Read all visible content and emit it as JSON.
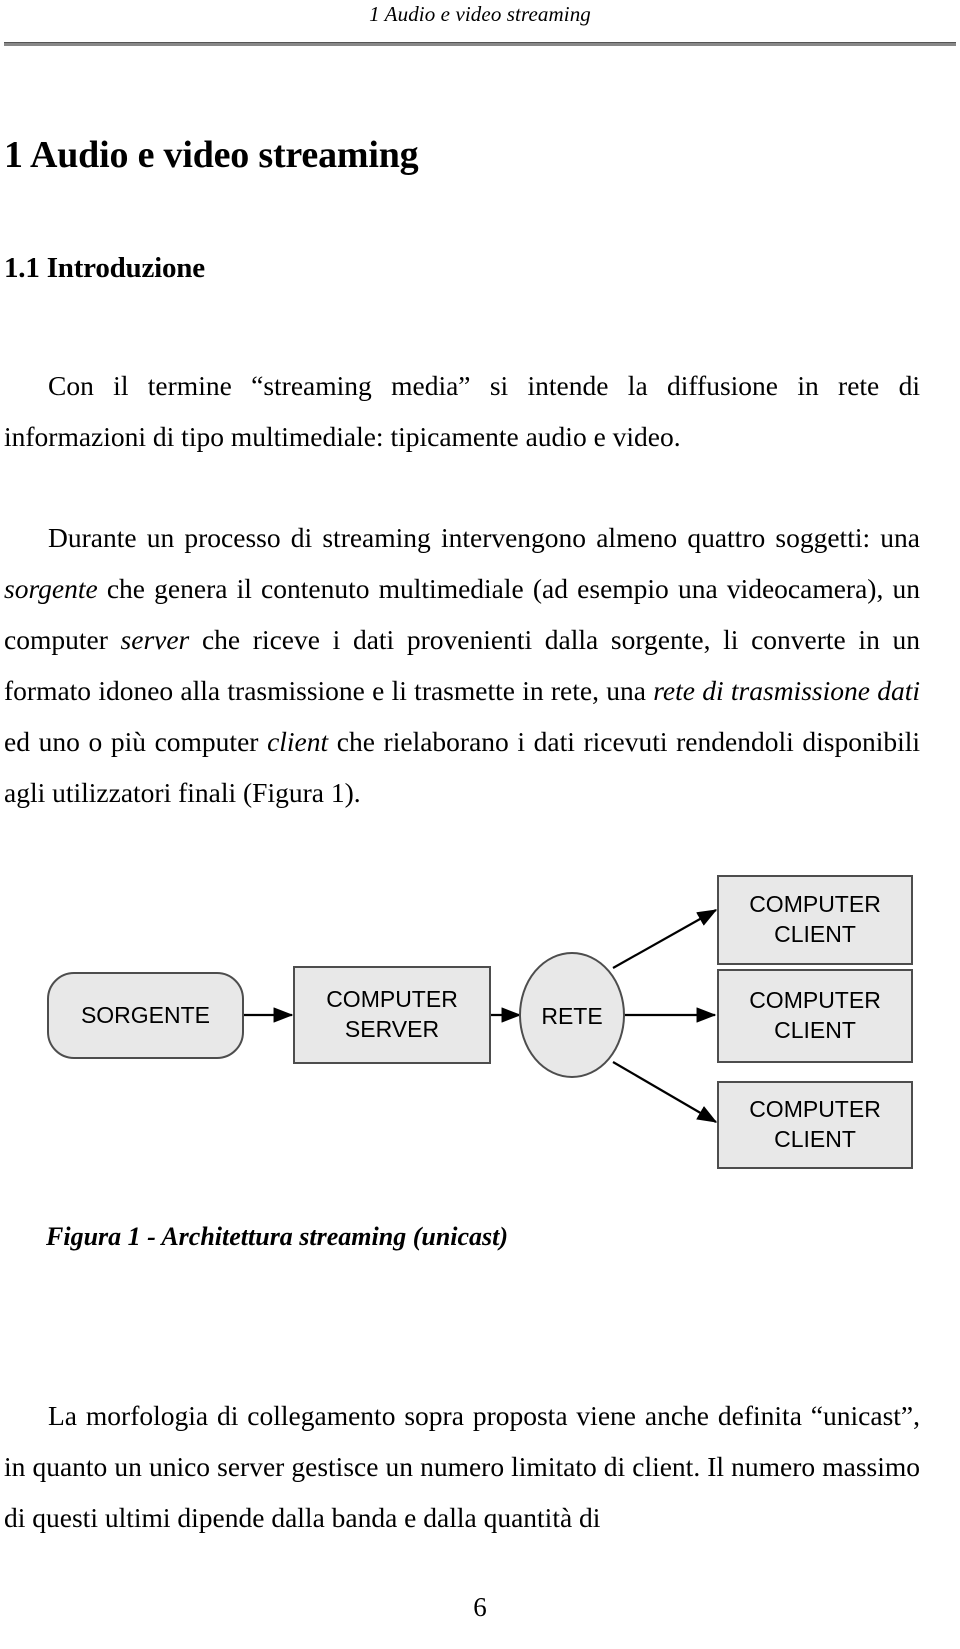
{
  "header": {
    "title": "1 Audio e video streaming"
  },
  "headings": {
    "chapter": "1 Audio e video streaming",
    "section": "1.1 Introduzione"
  },
  "paragraphs": {
    "p1": "Con il termine “streaming media” si intende la diffusione in rete di informazioni di tipo multimediale: tipicamente audio e video.",
    "p2_a": "Durante un processo di streaming intervengono almeno quattro soggetti: una ",
    "p2_i1": "sorgente",
    "p2_b": " che genera il contenuto multimediale (ad esempio una videocamera), un computer ",
    "p2_i2": "server",
    "p2_c": " che riceve i dati provenienti dalla sorgente, li converte in un formato idoneo alla trasmissione e li trasmette in rete, una ",
    "p2_i3": "rete di trasmissione dati",
    "p2_d": " ed uno o più computer ",
    "p2_i4": "client",
    "p2_e": " che rielaborano i dati ricevuti rendendoli disponibili agli utilizzatori finali (Figura 1).",
    "p3": "La morfologia di collegamento sopra proposta viene anche definita “unicast”, in quanto un unico server gestisce un numero limitato di client. Il numero massimo di questi ultimi dipende dalla banda e dalla quantità di"
  },
  "figure": {
    "caption": "Figura 1 - Architettura streaming (unicast)",
    "node_fill": "#e8e8e8",
    "node_stroke": "#4d4d4d",
    "nodes": {
      "sorgente": "SORGENTE",
      "server_line1": "COMPUTER",
      "server_line2": "SERVER",
      "rete": "RETE",
      "client1_line1": "COMPUTER",
      "client1_line2": "CLIENT",
      "client2_line1": "COMPUTER",
      "client2_line2": "CLIENT",
      "client3_line1": "COMPUTER",
      "client3_line2": "CLIENT"
    }
  },
  "footer": {
    "page_number": "6"
  }
}
